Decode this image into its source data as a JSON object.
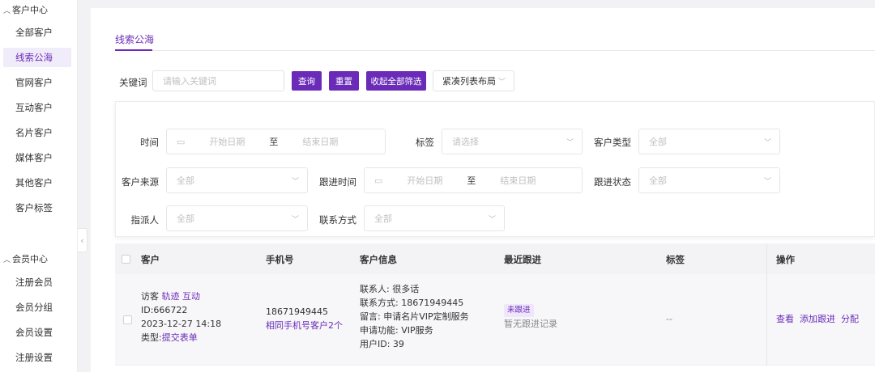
{
  "sidebar": {
    "groups": [
      {
        "title": "客户中心",
        "items": [
          "全部客户",
          "线索公海",
          "官网客户",
          "互动客户",
          "名片客户",
          "媒体客户",
          "其他客户",
          "客户标签"
        ]
      },
      {
        "title": "会员中心",
        "items": [
          "注册会员",
          "会员分组",
          "会员设置",
          "注册设置"
        ]
      }
    ]
  },
  "tab": {
    "label": "线索公海"
  },
  "search": {
    "keyword_label": "关键词",
    "keyword_placeholder": "请输入关键词",
    "query_label": "查询",
    "reset_label": "重置",
    "collapse_label": "收起全部筛选",
    "layout_select": "紧凑列表布局"
  },
  "filters": {
    "time_label": "时间",
    "time_start": "开始日期",
    "time_to": "至",
    "time_end": "结束日期",
    "tag_label": "标签",
    "tag_placeholder": "请选择",
    "type_label": "客户类型",
    "type_value": "全部",
    "source_label": "客户来源",
    "source_value": "全部",
    "follow_time_label": "跟进时间",
    "follow_start": "开始日期",
    "follow_to": "至",
    "follow_end": "结束日期",
    "follow_status_label": "跟进状态",
    "follow_status_value": "全部",
    "assignee_label": "指派人",
    "assignee_value": "全部",
    "contact_label": "联系方式",
    "contact_value": "全部"
  },
  "table": {
    "headers": {
      "customer": "客户",
      "phone": "手机号",
      "info": "客户信息",
      "latest": "最近跟进",
      "tags": "标签",
      "ops": "操作"
    },
    "row": {
      "visitor": "访客",
      "trail": "轨迹",
      "interact": "互动",
      "id": "ID:666722",
      "datetime": "2023-12-27 14:18",
      "type_prefix": "类型:",
      "type_value": "提交表单",
      "phone": "18671949445",
      "same_phone": "相同手机号客户2个",
      "info_contact": "联系人: 很多话",
      "info_method": "联系方式: 18671949445",
      "info_message": "留言: 申请名片VIP定制服务",
      "info_feature": "申请功能: VIP服务",
      "info_userid": "用户ID: 39",
      "status_badge": "未跟进",
      "no_record": "暂无跟进记录",
      "tags": "--",
      "op_view": "查看",
      "op_add": "添加跟进",
      "op_assign": "分配"
    }
  },
  "colors": {
    "accent": "#6a2bb8",
    "active_bg": "#f1ecfa",
    "header_bg": "#f3f3f5"
  }
}
